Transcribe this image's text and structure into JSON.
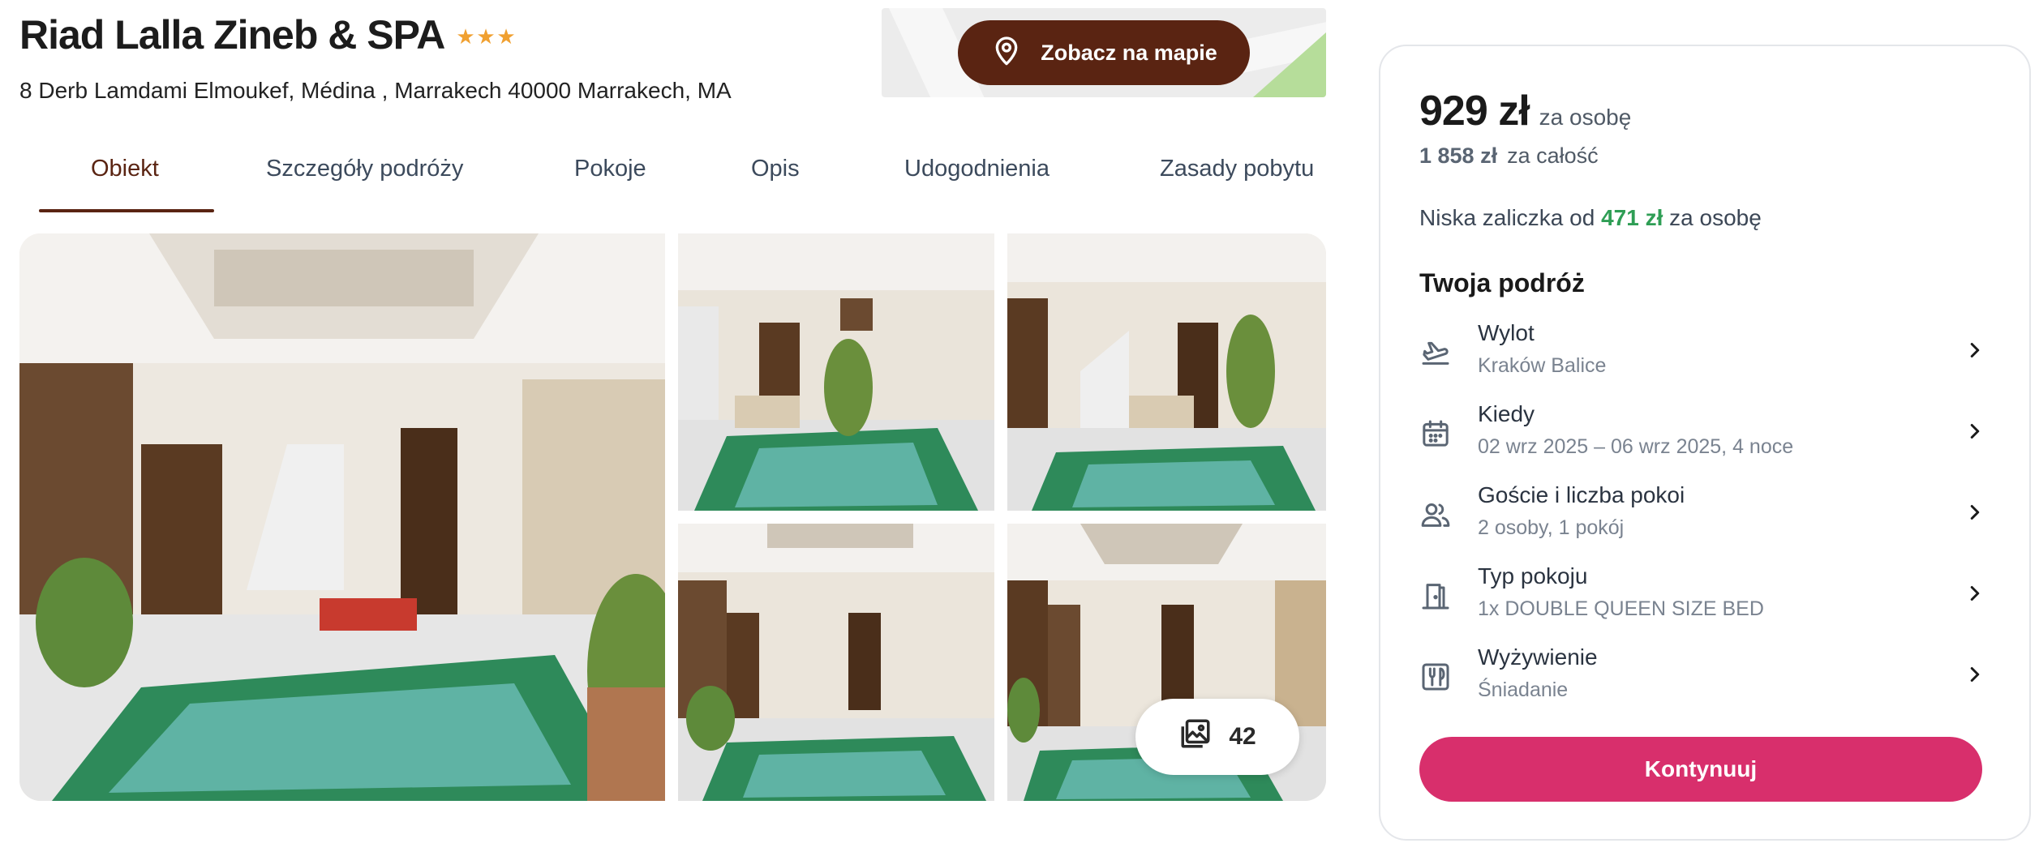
{
  "hotel": {
    "name": "Riad Lalla Zineb & SPA",
    "stars": 3,
    "address": "8 Derb Lamdami Elmoukef, Médina , Marrakech 40000 Marrakech, MA"
  },
  "map": {
    "button_label": "Zobacz na mapie",
    "icon": "map-pin-icon"
  },
  "tabs": [
    {
      "label": "Obiekt",
      "active": true
    },
    {
      "label": "Szczegóły podróży",
      "active": false
    },
    {
      "label": "Pokoje",
      "active": false
    },
    {
      "label": "Opis",
      "active": false
    },
    {
      "label": "Udogodnienia",
      "active": false
    },
    {
      "label": "Zasady pobytu",
      "active": false
    }
  ],
  "gallery": {
    "photo_count": "42",
    "count_icon": "image-gallery-icon"
  },
  "booking": {
    "price": "929 zł",
    "price_unit": "za osobę",
    "total_amount": "1 858 zł",
    "total_label": "za całość",
    "deposit_prefix": "Niska zaliczka od",
    "deposit_amount": "471 zł",
    "deposit_suffix": "za osobę",
    "trip_title": "Twoja podróż",
    "items": [
      {
        "label": "Wylot",
        "value": "Kraków Balice",
        "icon": "plane-takeoff-icon"
      },
      {
        "label": "Kiedy",
        "value": "02 wrz 2025 – 06 wrz 2025, 4 noce",
        "icon": "calendar-icon"
      },
      {
        "label": "Goście i liczba pokoi",
        "value": "2 osoby, 1 pokój",
        "icon": "users-icon"
      },
      {
        "label": "Typ pokoju",
        "value": "1x DOUBLE QUEEN SIZE BED",
        "icon": "door-icon"
      },
      {
        "label": "Wyżywienie",
        "value": "Śniadanie",
        "icon": "cutlery-icon"
      }
    ],
    "continue_label": "Kontynuuj"
  },
  "colors": {
    "brand_brown": "#5a2412",
    "accent_pink": "#d82f6c",
    "deposit_green": "#2f9e55",
    "star_orange": "#f0a030"
  }
}
